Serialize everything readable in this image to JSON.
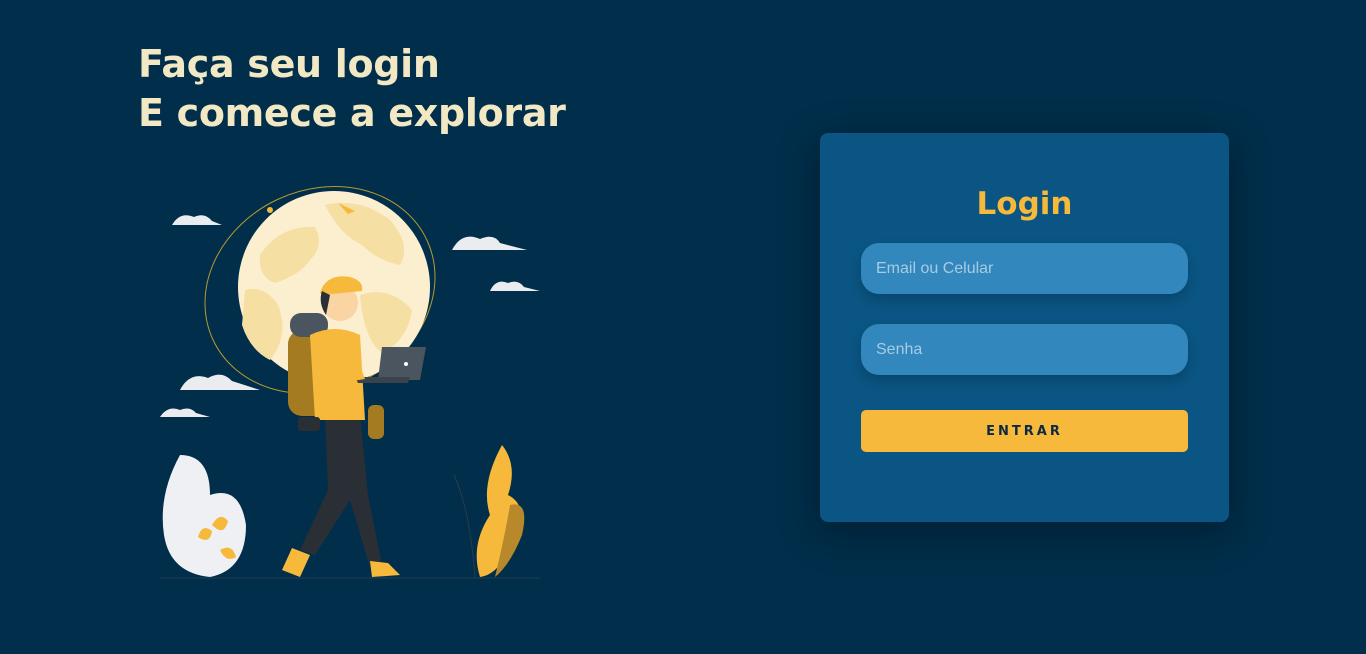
{
  "hero": {
    "line1": "Faça seu login",
    "line2": "E comece a explorar"
  },
  "login": {
    "title": "Login",
    "email_placeholder": "Email ou Celular",
    "password_placeholder": "Senha",
    "submit_label": "ENTRAR"
  },
  "colors": {
    "background": "#012e4a",
    "card": "#0a5583",
    "input": "#3287bd",
    "accent": "#f6b93b",
    "headline": "#f2e8c4"
  },
  "illustration": {
    "icon": "traveler-with-globe-illustration"
  }
}
